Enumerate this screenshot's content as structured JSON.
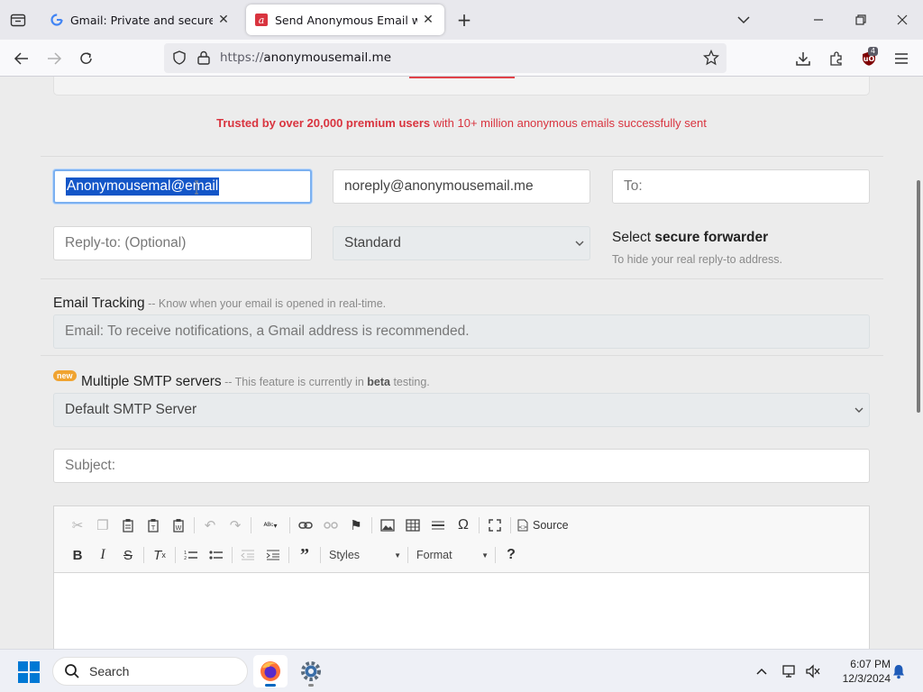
{
  "browser": {
    "tabs": [
      {
        "title": "Gmail: Private and secure email",
        "active": false
      },
      {
        "title": "Send Anonymous Email with the",
        "active": true
      }
    ],
    "url_scheme": "https://",
    "url_host": "anonymousemail.me",
    "extension_badge": "4"
  },
  "page": {
    "trusted_bold": "Trusted by over 20,000 premium users",
    "trusted_rest": " with 10+ million anonymous emails successfully sent",
    "from_name_value": "Anonymousemal@email",
    "from_email_value": "noreply@anonymousemail.me",
    "to_placeholder": "To:",
    "reply_to_placeholder": "Reply-to: (Optional)",
    "forwarder_select": "Standard",
    "forwarder_label_prefix": "Select ",
    "forwarder_label_bold": "secure forwarder",
    "forwarder_hint": "To hide your real reply-to address.",
    "tracking_label": "Email Tracking",
    "tracking_hint": " -- Know when your email is opened in real-time.",
    "tracking_placeholder": "Email: To receive notifications, a Gmail address is recommended.",
    "new_badge": "new",
    "smtp_label": "Multiple SMTP servers",
    "smtp_hint_prefix": " -- This feature is currently in ",
    "smtp_hint_bold": "beta",
    "smtp_hint_suffix": " testing.",
    "smtp_select": "Default SMTP Server",
    "subject_placeholder": "Subject:",
    "editor": {
      "source_label": "Source",
      "styles_label": "Styles",
      "format_label": "Format"
    }
  },
  "taskbar": {
    "search_label": "Search",
    "time": "6:07 PM",
    "date": "12/3/2024"
  },
  "colors": {
    "accent_red": "#d9343f",
    "selection_blue": "#1356c8",
    "focus_blue": "#7bb0f0"
  }
}
